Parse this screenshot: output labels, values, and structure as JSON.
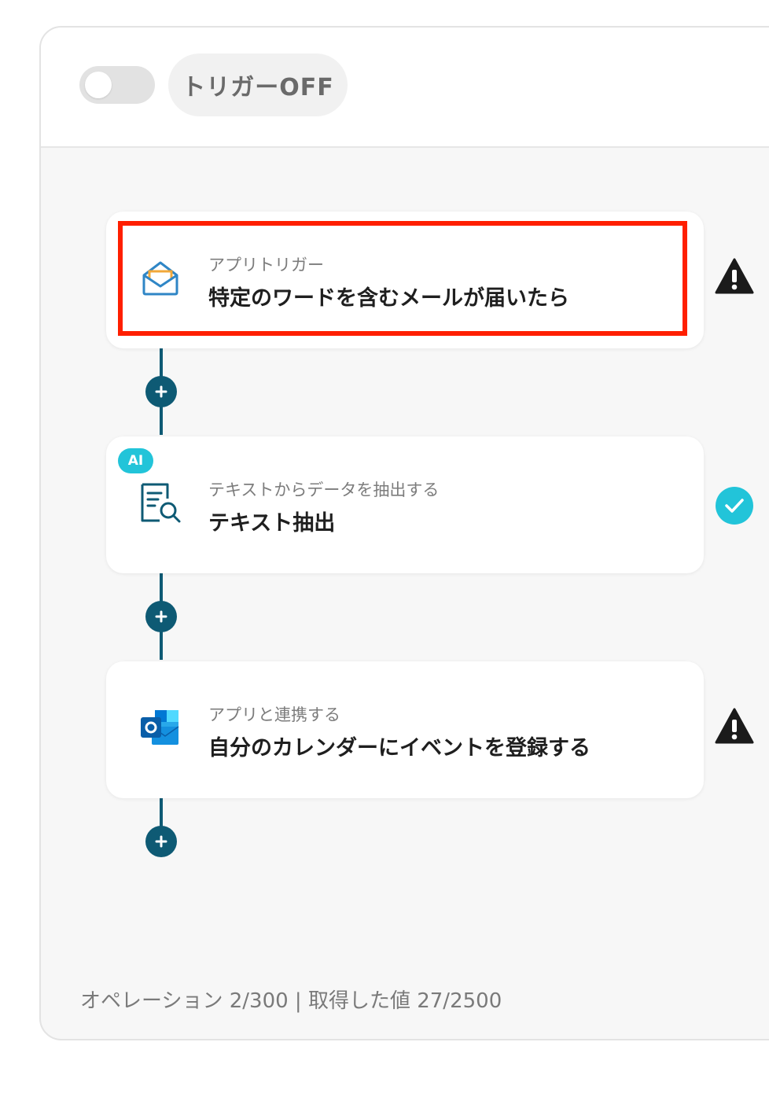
{
  "header": {
    "toggle_state": "off",
    "trigger_label": "トリガーOFF"
  },
  "steps": [
    {
      "subtitle": "アプリトリガー",
      "title": "特定のワードを含むメールが届いたら",
      "icon": "email-open-icon",
      "status": "warning",
      "highlighted": true
    },
    {
      "badge": "AI",
      "subtitle": "テキストからデータを抽出する",
      "title": "テキスト抽出",
      "icon": "document-search-icon",
      "status": "complete"
    },
    {
      "subtitle": "アプリと連携する",
      "title": "自分のカレンダーにイベントを登録する",
      "icon": "outlook-icon",
      "status": "warning"
    }
  ],
  "footer": {
    "usage_text": "オペレーション 2/300 | 取得した値 27/2500"
  },
  "colors": {
    "connector": "#0e5a74",
    "highlight": "#ff1f00",
    "ai_badge": "#22c4d9",
    "check": "#22c4d9",
    "warning": "#1b1b1b"
  }
}
